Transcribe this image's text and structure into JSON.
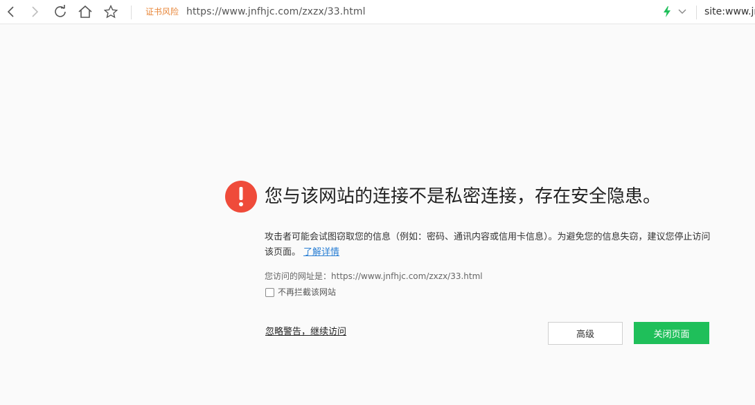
{
  "toolbar": {
    "icons": {
      "back": "back-arrow-icon",
      "forward": "forward-arrow-icon",
      "reload": "reload-icon",
      "home": "home-icon",
      "bookmark": "star-icon",
      "speed_mode": "lightning-icon",
      "dropdown": "chevron-down-icon"
    },
    "cert_risk_label": "证书风险",
    "url": "https://www.jnfhjc.com/zxzx/33.html",
    "search_text": "site:www.jnfhjc"
  },
  "warning": {
    "icon": "exclamation-circle-icon",
    "title": "您与该网站的连接不是私密连接，存在安全隐患。",
    "description": "攻击者可能会试图窃取您的信息（例如：密码、通讯内容或信用卡信息）。为避免您的信息失窃，建议您停止访问该页面。",
    "learn_more": "了解详情",
    "visited_url_label": "您访问的网址是：",
    "visited_url": "https://www.jnfhjc.com/zxzx/33.html",
    "dont_block_label": "不再拦截该网站",
    "dont_block_checked": false,
    "ignore_link": "忽略警告，继续访问",
    "advanced_button": "高级",
    "close_button": "关闭页面"
  },
  "colors": {
    "warning_red": "#ef4b3a",
    "cert_risk_orange": "#e8873a",
    "link_blue": "#2a7fd4",
    "close_green": "#1fbf5a",
    "speed_green": "#1fbf5a"
  }
}
